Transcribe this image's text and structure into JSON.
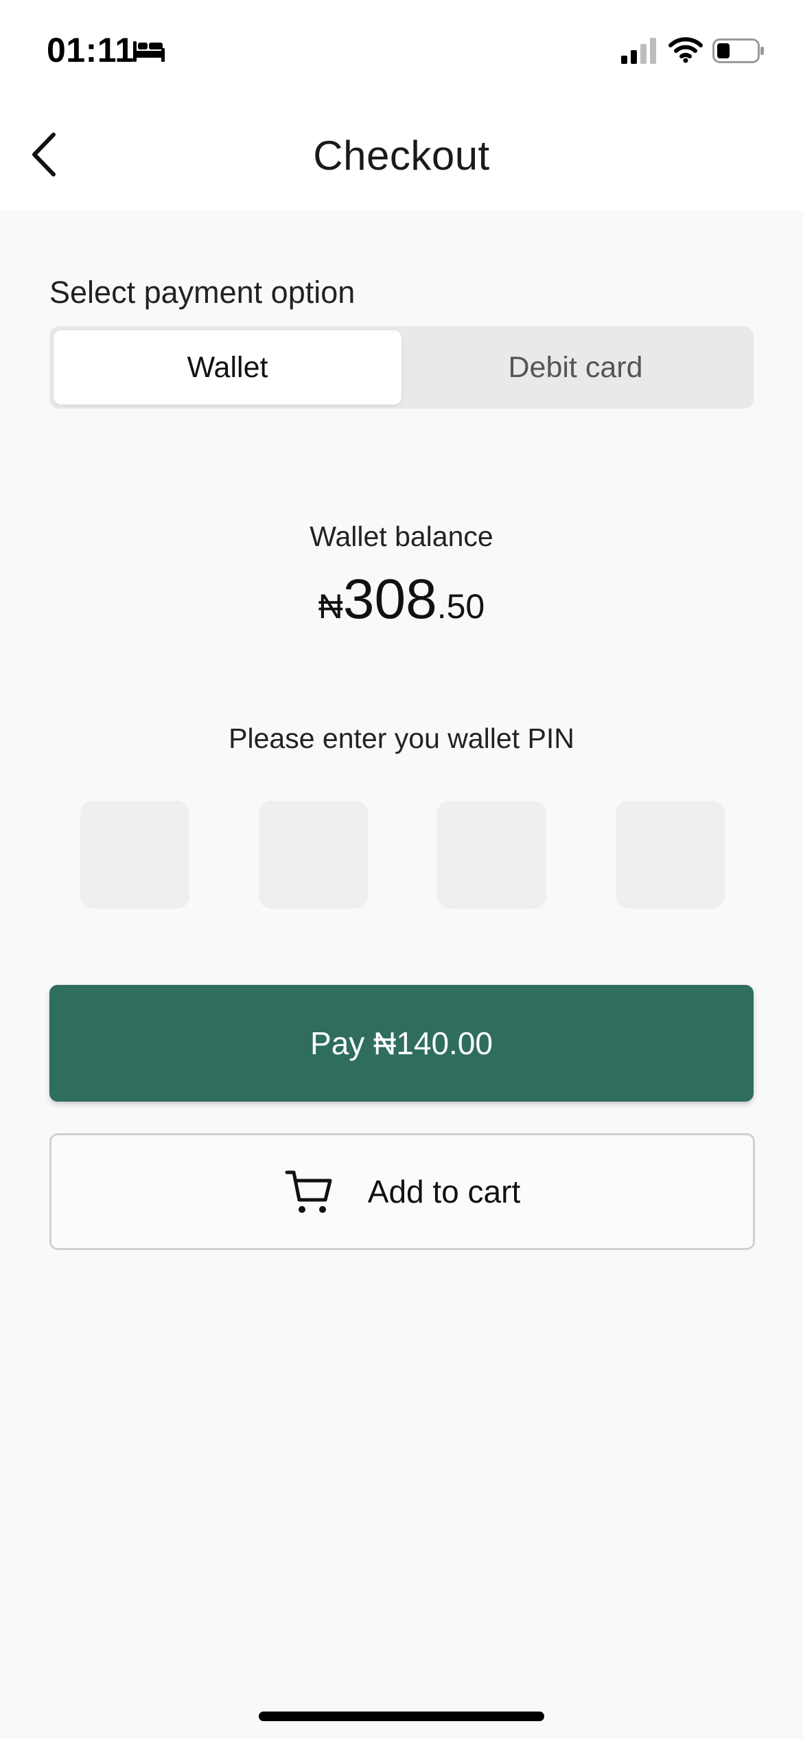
{
  "status_bar": {
    "time": "01:11"
  },
  "nav": {
    "title": "Checkout"
  },
  "payment": {
    "section_label": "Select payment option",
    "tabs": [
      {
        "label": "Wallet",
        "selected": true
      },
      {
        "label": "Debit card",
        "selected": false
      }
    ]
  },
  "wallet": {
    "balance_label": "Wallet balance",
    "currency": "₦",
    "balance_integer": "308",
    "balance_decimal": ".50"
  },
  "pin": {
    "prompt": "Please enter you wallet PIN",
    "digits": [
      "",
      "",
      "",
      ""
    ]
  },
  "actions": {
    "pay_label": "Pay ₦140.00",
    "cart_label": "Add to cart"
  },
  "colors": {
    "primary": "#2f6d5e",
    "background": "#f9f9f9"
  },
  "icons": {
    "back": "chevron-left-icon",
    "cart": "cart-icon",
    "sleep": "bed-icon",
    "signal": "cellular-signal-icon",
    "wifi": "wifi-icon",
    "battery": "battery-icon"
  }
}
